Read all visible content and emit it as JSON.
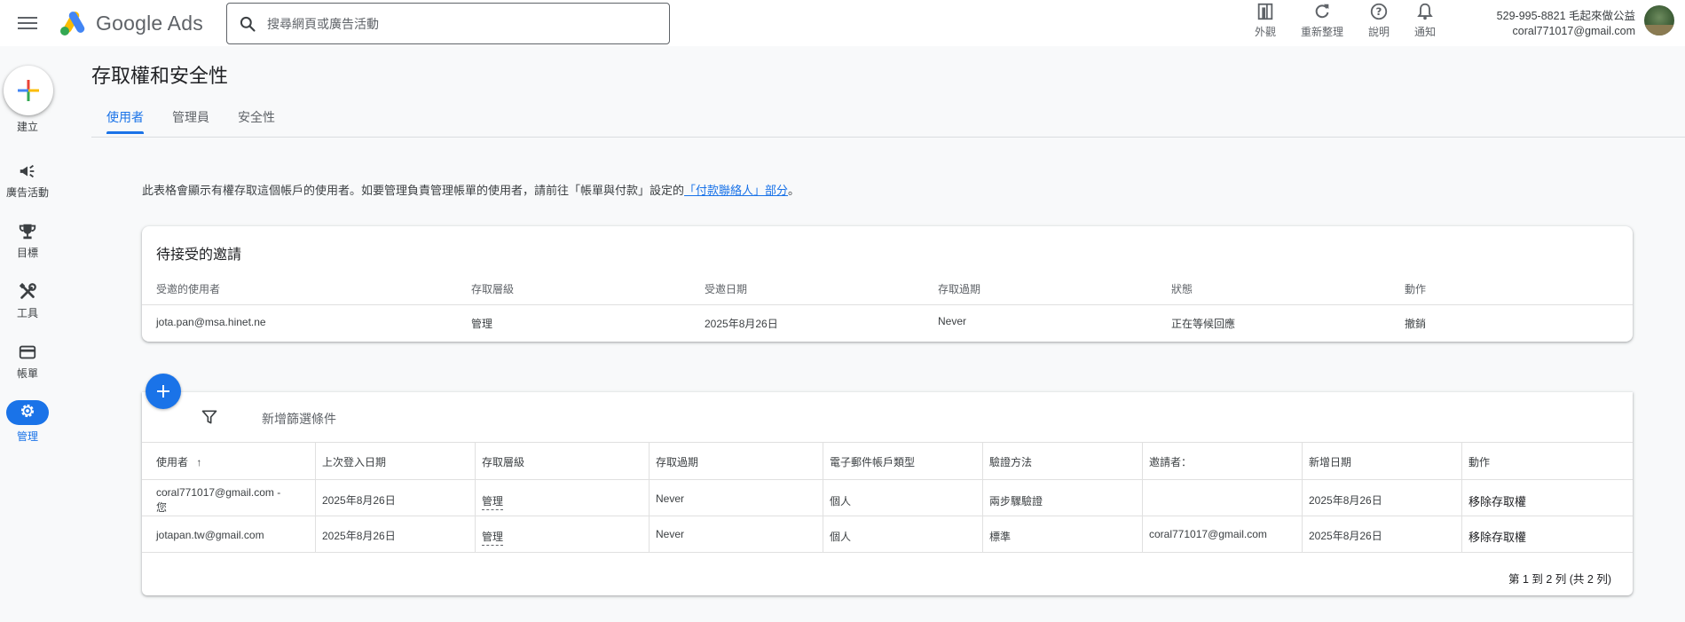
{
  "header": {
    "app_name": "Google Ads",
    "search_placeholder": "搜尋網頁或廣告活動",
    "actions": [
      {
        "label": "外觀",
        "icon": "appearance-icon"
      },
      {
        "label": "重新整理",
        "icon": "refresh-icon"
      },
      {
        "label": "說明",
        "icon": "help-icon"
      },
      {
        "label": "通知",
        "icon": "bell-icon"
      }
    ],
    "account_line1": "529-995-8821 毛起來做公益",
    "account_line2": "coral771017@gmail.com"
  },
  "nav": {
    "create_label": "建立",
    "items": [
      {
        "label": "廣告活動",
        "icon": "megaphone-icon"
      },
      {
        "label": "目標",
        "icon": "trophy-icon"
      },
      {
        "label": "工具",
        "icon": "tools-icon"
      },
      {
        "label": "帳單",
        "icon": "credit-card-icon"
      },
      {
        "label": "管理",
        "icon": "gear-icon",
        "active": true
      }
    ]
  },
  "page": {
    "title": "存取權和安全性",
    "tabs": [
      "使用者",
      "管理員",
      "安全性"
    ],
    "info_text": "此表格會顯示有權存取這個帳戶的使用者。如要管理負責管理帳單的使用者，請前往「帳單與付款」設定的",
    "info_link": "「付款聯絡人」部分",
    "info_end": "。"
  },
  "invites": {
    "title": "待接受的邀請",
    "headers": [
      "受邀的使用者",
      "存取層級",
      "受邀日期",
      "存取過期",
      "狀態",
      "動作"
    ],
    "row": [
      "jota.pan@msa.hinet.ne",
      "管理",
      "2025年8月26日",
      "Never",
      "正在等候回應",
      "撤銷"
    ]
  },
  "users": {
    "filter_label": "新增篩選條件",
    "headers": [
      "使用者",
      "上次登入日期",
      "存取層級",
      "存取過期",
      "電子郵件帳戶類型",
      "驗證方法",
      "邀請者：",
      "新增日期",
      "動作"
    ],
    "sort_arrow": "↑",
    "rows": [
      {
        "user_line1": "coral771017@gmail.com -",
        "user_line2": "您",
        "last_login": "2025年8月26日",
        "access": "管理",
        "expiry": "Never",
        "account_type": "個人",
        "auth": "兩步驟驗證",
        "inviter": "",
        "added": "2025年8月26日",
        "action": "移除存取權"
      },
      {
        "user_line1": "jotapan.tw@gmail.com",
        "user_line2": "",
        "last_login": "2025年8月26日",
        "access": "管理",
        "expiry": "Never",
        "account_type": "個人",
        "auth": "標準",
        "inviter": "coral771017@gmail.com",
        "added": "2025年8月26日",
        "action": "移除存取權"
      }
    ],
    "pagination": "第 1 到 2 列 (共 2 列)"
  },
  "colors": {
    "accent": "#1a73e8"
  }
}
